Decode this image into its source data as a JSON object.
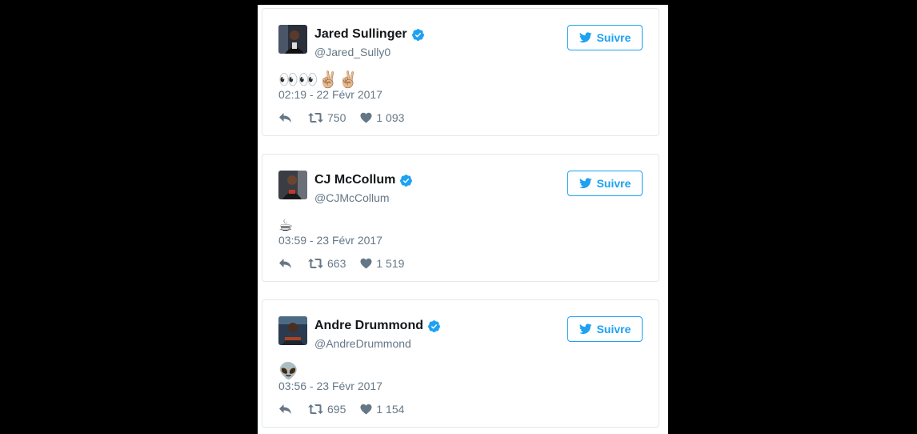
{
  "colors": {
    "accent": "#1da1f2",
    "verified": "#1da1f2",
    "text": "#14171a",
    "muted": "#657786",
    "border": "#e1e8ed"
  },
  "tweets": [
    {
      "name": "Jared Sullinger",
      "handle": "@Jared_Sully0",
      "content": "👀👀✌🏼✌🏼",
      "timestamp": "02:19 - 22 Févr 2017",
      "retweets": "750",
      "likes": "1 093",
      "follow_label": "Suivre",
      "verified": true
    },
    {
      "name": "CJ McCollum",
      "handle": "@CJMcCollum",
      "content": "☕",
      "timestamp": "03:59 - 23 Févr 2017",
      "retweets": "663",
      "likes": "1 519",
      "follow_label": "Suivre",
      "verified": true
    },
    {
      "name": "Andre Drummond",
      "handle": "@AndreDrummond",
      "content": "👽",
      "timestamp": "03:56 - 23 Févr 2017",
      "retweets": "695",
      "likes": "1 154",
      "follow_label": "Suivre",
      "verified": true
    }
  ],
  "icons": {
    "verified": "verified-badge-icon",
    "follow": "twitter-bird-icon",
    "reply": "reply-icon",
    "retweet": "retweet-icon",
    "like": "heart-icon"
  }
}
